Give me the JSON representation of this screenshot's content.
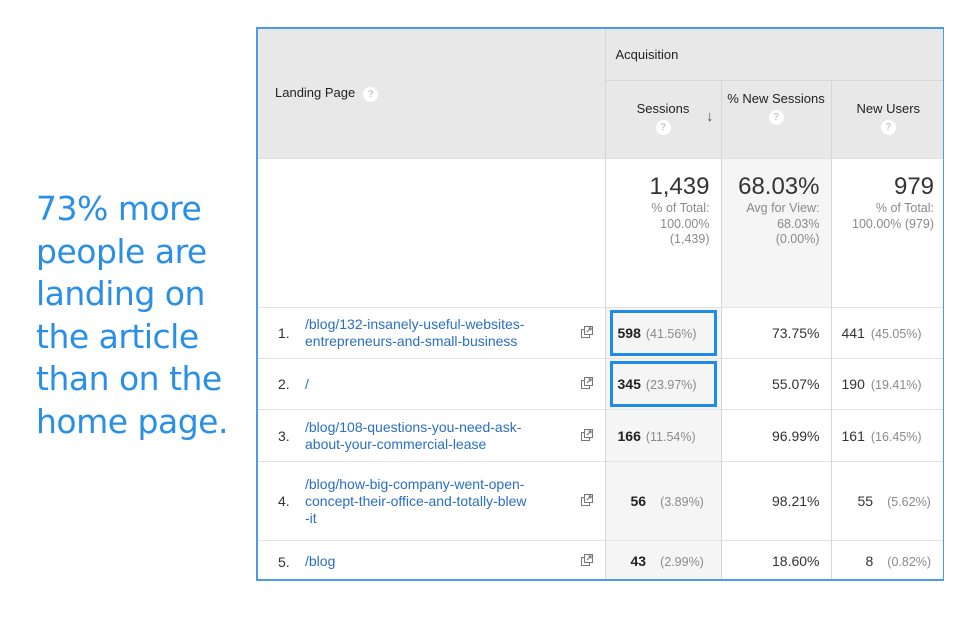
{
  "callout": {
    "lines": [
      "73% more",
      "people are",
      "landing on",
      "the article",
      "than on the",
      "home page."
    ],
    "color": "#2a8fe6"
  },
  "table": {
    "group_header": "Acquisition",
    "dimension_header": "Landing Page",
    "help_glyph": "?",
    "columns": {
      "sessions": "Sessions",
      "sessions_sort_icon": "↓",
      "pct_new_sessions": "% New Sessions",
      "new_users": "New Users"
    },
    "totals": {
      "sessions": {
        "value": "1,439",
        "l1": "% of Total:",
        "l2": "100.00%",
        "l3": "(1,439)"
      },
      "pct_new_sessions": {
        "value": "68.03%",
        "l1": "Avg for View:",
        "l2": "68.03%",
        "l3": "(0.00%)"
      },
      "new_users": {
        "value": "979",
        "l1": "% of Total:",
        "l2": "100.00% (979)"
      }
    },
    "rows": [
      {
        "index": "1.",
        "url": "/blog/132-insanely-useful-websites-entrepreneurs-and-small-business",
        "sessions": "598",
        "sessions_pct": "(41.56%)",
        "pct_new_sessions": "73.75%",
        "new_users": "441",
        "new_users_pct": "(45.05%)",
        "highlighted": true
      },
      {
        "index": "2.",
        "url": "/",
        "sessions": "345",
        "sessions_pct": "(23.97%)",
        "pct_new_sessions": "55.07%",
        "new_users": "190",
        "new_users_pct": "(19.41%)",
        "highlighted": true
      },
      {
        "index": "3.",
        "url": "/blog/108-questions-you-need-ask-about-your-commercial-lease",
        "sessions": "166",
        "sessions_pct": "(11.54%)",
        "pct_new_sessions": "96.99%",
        "new_users": "161",
        "new_users_pct": "(16.45%)",
        "highlighted": false
      },
      {
        "index": "4.",
        "url": "/blog/how-big-company-went-open-concept-their-office-and-totally-blew-it",
        "sessions": "56",
        "sessions_pct": "(3.89%)",
        "pct_new_sessions": "98.21%",
        "new_users": "55",
        "new_users_pct": "(5.62%)",
        "highlighted": false
      },
      {
        "index": "5.",
        "url": "/blog",
        "sessions": "43",
        "sessions_pct": "(2.99%)",
        "pct_new_sessions": "18.60%",
        "new_users": "8",
        "new_users_pct": "(0.82%)",
        "highlighted": false
      }
    ],
    "row_url_display": [
      [
        "/blog/132-insanely-useful-websites-",
        "entrepreneurs-and-small-business"
      ],
      [
        "/"
      ],
      [
        "/blog/108-questions-you-need-ask-",
        "about-your-commercial-lease"
      ],
      [
        "/blog/how-big-company-went-open-",
        "concept-their-office-and-totally-blew",
        "-it"
      ],
      [
        "/blog"
      ]
    ],
    "highlight_color": "#1f8be8",
    "link_color": "#2a6fc2"
  }
}
